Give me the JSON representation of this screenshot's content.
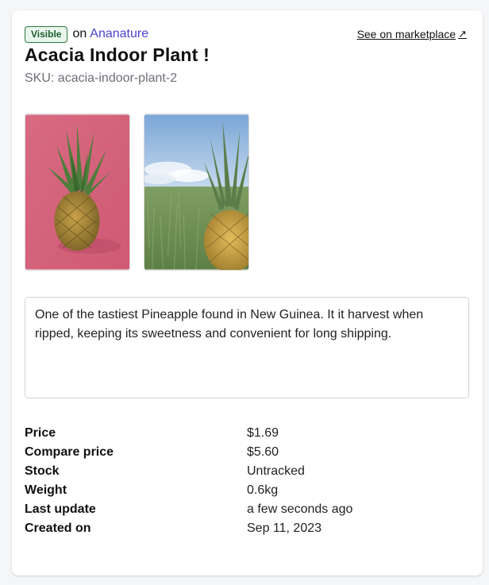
{
  "header": {
    "badge": "Visible",
    "on_text": "on",
    "store_name": "Ananature",
    "marketplace_link": "See on marketplace",
    "title": "Acacia Indoor Plant !",
    "sku": "SKU: acacia-indoor-plant-2"
  },
  "images": [
    {
      "name": "pineapple-pink-background-photo"
    },
    {
      "name": "pineapple-grass-field-photo"
    }
  ],
  "description": "One of the tastiest Pineapple found in New Guinea. It it harvest when ripped, keeping its sweetness and convenient for long shipping.",
  "specs": [
    {
      "label": "Price",
      "value": "$1.69"
    },
    {
      "label": "Compare price",
      "value": "$5.60"
    },
    {
      "label": "Stock",
      "value": "Untracked"
    },
    {
      "label": "Weight",
      "value": "0.6kg"
    },
    {
      "label": "Last update",
      "value": "a few seconds ago"
    },
    {
      "label": "Created on",
      "value": "Sep 11, 2023"
    }
  ],
  "colors": {
    "accent_link": "#4a43c9",
    "badge_text": "#1e5e2e",
    "badge_bg": "#e9f6ec"
  },
  "icons": {
    "external": "arrow-up-right-icon"
  }
}
